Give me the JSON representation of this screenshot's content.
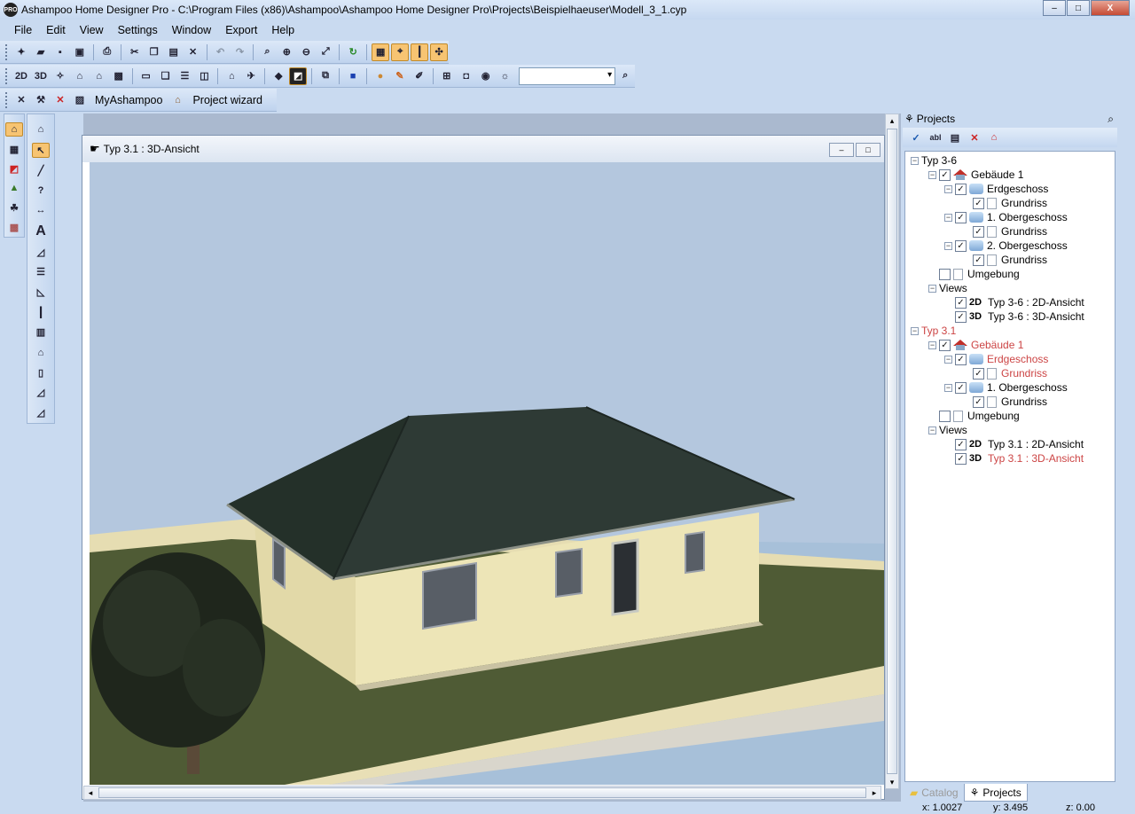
{
  "app": {
    "title": "Ashampoo Home Designer Pro - C:\\Program Files (x86)\\Ashampoo\\Ashampoo Home Designer Pro\\Projects\\Beispielhaeuser\\Modell_3_1.cyp",
    "icon_text": "PRO"
  },
  "window_buttons": {
    "minimize": "–",
    "maximize": "□",
    "close": "X"
  },
  "menu": [
    "File",
    "Edit",
    "View",
    "Settings",
    "Window",
    "Export",
    "Help"
  ],
  "toolbar3": {
    "myashampoo": "MyAshampoo",
    "project_wizard": "Project wizard"
  },
  "toolbar2": {
    "btn_2d": "2D",
    "btn_3d": "3D"
  },
  "view_window": {
    "title": "Typ 3.1 : 3D-Ansicht"
  },
  "panel": {
    "title": "Projects",
    "tree": [
      {
        "id": "n0",
        "label": "Typ 3-6",
        "level": 0,
        "exp": "−",
        "highlight": false
      },
      {
        "id": "n1",
        "label": "Gebäude 1",
        "level": 1,
        "exp": "−",
        "cb": "✓",
        "icon": "bldg",
        "highlight": false
      },
      {
        "id": "n2",
        "label": "Erdgeschoss",
        "level": 2,
        "exp": "−",
        "cb": "✓",
        "icon": "floor",
        "highlight": false
      },
      {
        "id": "n3",
        "label": "Grundriss",
        "level": 3,
        "cb": "✓",
        "icon": "page",
        "highlight": false
      },
      {
        "id": "n4",
        "label": "1. Obergeschoss",
        "level": 2,
        "exp": "−",
        "cb": "✓",
        "icon": "floor",
        "highlight": false
      },
      {
        "id": "n5",
        "label": "Grundriss",
        "level": 3,
        "cb": "✓",
        "icon": "page",
        "highlight": false
      },
      {
        "id": "n6",
        "label": "2. Obergeschoss",
        "level": 2,
        "exp": "−",
        "cb": "✓",
        "icon": "floor",
        "highlight": false
      },
      {
        "id": "n7",
        "label": "Grundriss",
        "level": 3,
        "cb": "✓",
        "icon": "page",
        "highlight": false
      },
      {
        "id": "n8",
        "label": "Umgebung",
        "level": 1,
        "cb": "",
        "icon": "page",
        "highlight": false
      },
      {
        "id": "n9",
        "label": "Views",
        "level": 1,
        "exp": "−",
        "highlight": false
      },
      {
        "id": "n10",
        "label": "Typ 3-6 : 2D-Ansicht",
        "level": 2,
        "cb": "✓",
        "vtag": "2D",
        "highlight": false
      },
      {
        "id": "n11",
        "label": "Typ 3-6 : 3D-Ansicht",
        "level": 2,
        "cb": "✓",
        "vtag": "3D",
        "highlight": false
      },
      {
        "id": "n12",
        "label": "Typ 3.1",
        "level": 0,
        "exp": "−",
        "highlight": true
      },
      {
        "id": "n13",
        "label": "Gebäude 1",
        "level": 1,
        "exp": "−",
        "cb": "✓",
        "icon": "bldg",
        "highlight": true
      },
      {
        "id": "n14",
        "label": "Erdgeschoss",
        "level": 2,
        "exp": "−",
        "cb": "✓",
        "icon": "floor",
        "highlight": true
      },
      {
        "id": "n15",
        "label": "Grundriss",
        "level": 3,
        "cb": "✓",
        "icon": "page",
        "highlight": true
      },
      {
        "id": "n16",
        "label": "1. Obergeschoss",
        "level": 2,
        "exp": "−",
        "cb": "✓",
        "icon": "floor",
        "highlight": false
      },
      {
        "id": "n17",
        "label": "Grundriss",
        "level": 3,
        "cb": "✓",
        "icon": "page",
        "highlight": false
      },
      {
        "id": "n18",
        "label": "Umgebung",
        "level": 1,
        "cb": "",
        "icon": "page",
        "highlight": false
      },
      {
        "id": "n19",
        "label": "Views",
        "level": 1,
        "exp": "−",
        "highlight": false
      },
      {
        "id": "n20",
        "label": "Typ 3.1 : 2D-Ansicht",
        "level": 2,
        "cb": "✓",
        "vtag": "2D",
        "highlight": false
      },
      {
        "id": "n21",
        "label": "Typ 3.1 : 3D-Ansicht",
        "level": 2,
        "cb": "✓",
        "vtag": "3D",
        "highlight": true
      }
    ],
    "tabs": [
      {
        "label": "Catalog",
        "active": false
      },
      {
        "label": "Projects",
        "active": true
      }
    ]
  },
  "status": {
    "x": "x: 1.0027",
    "y": "y: 3.495",
    "z": "z: 0.00"
  },
  "colors": {
    "sky": "#b6c8df",
    "grass": "#4e5a34",
    "wall": "#ede5b6",
    "roof": "#2c3a36",
    "path": "#e9dfb4",
    "water": "#a3bfd8",
    "highlight_text": "#cc4444"
  }
}
